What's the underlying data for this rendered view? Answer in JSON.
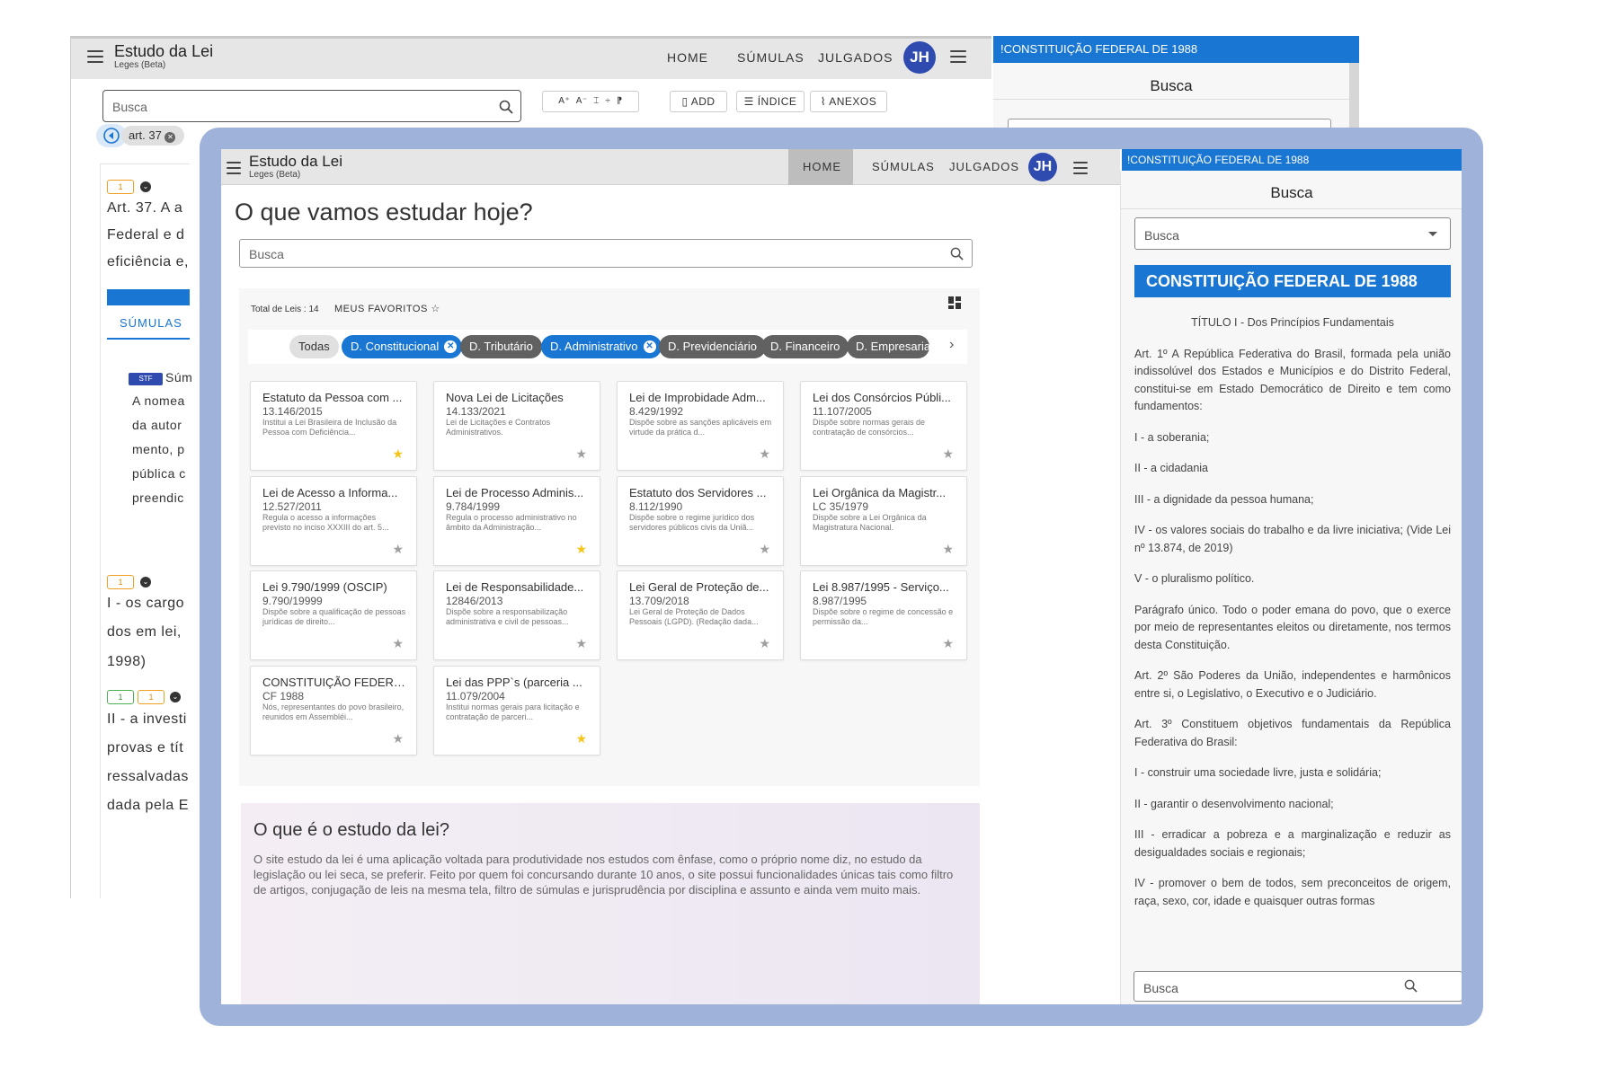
{
  "app": {
    "title": "Estudo da Lei",
    "subtitle": "Leges (Beta)",
    "avatar": "JH"
  },
  "nav": {
    "home": "HOME",
    "sumulas": "SÚMULAS",
    "julgados": "JULGADOS"
  },
  "right_panel": {
    "header": "!CONSTITUIÇÃO FEDERAL DE 1988",
    "busca_title": "Busca",
    "select_placeholder": "Busca",
    "law_title": "CONSTITUIÇÃO FEDERAL DE 1988",
    "paragraphs": [
      "TÍTULO I - Dos Princípios Fundamentais",
      "Art. 1º A República Federativa do Brasil, formada pela união indissolúvel dos Estados e Municípios e do Distrito Federal, constitui-se em Estado Democrático de Direito e tem como fundamentos:",
      "I - a soberania;",
      "II - a cidadania",
      "III - a dignidade da pessoa humana;",
      "IV - os valores sociais do trabalho e da livre iniciativa; (Vide Lei nº 13.874, de 2019)",
      "V - o pluralismo político.",
      "Parágrafo único. Todo o poder emana do povo, que o exerce por meio de representantes eleitos ou diretamente, nos termos desta Constituição.",
      "Art. 2º São Poderes da União, independentes e harmônicos entre si, o Legislativo, o Executivo e o Judiciário.",
      "Art. 3º Constituem objetivos fundamentais da República Federativa do Brasil:",
      "I - construir uma sociedade livre, justa e solidária;",
      "II - garantir o desenvolvimento nacional;",
      "III - erradicar a pobreza e a marginalização e reduzir as desigualdades sociais e regionais;",
      "IV - promover o bem de todos, sem preconceitos de origem, raça, sexo, cor, idade e quaisquer outras formas"
    ],
    "bottom_search_placeholder": "Busca"
  },
  "background": {
    "search_placeholder": "Busca",
    "tools": {
      "add": "ADD",
      "indice": "ÍNDICE",
      "anexos": "ANEXOS"
    },
    "art_chip": "art. 37",
    "badge": "1",
    "sumulas_tab": "SÚMULAS",
    "stf_label": "STF",
    "text_lines": [
      "Art. 37. A a",
      "Federal e d",
      "eficiência e,",
      "Súm",
      "A nomea",
      "da autor",
      "mento, p",
      "pública c",
      "preendic",
      "I - os cargo",
      "dos em lei,",
      "1998)",
      "II - a investi",
      "provas e tít",
      "ressalvadas",
      "dada pela E"
    ]
  },
  "main": {
    "headline": "O que vamos estudar hoje?",
    "search_placeholder": "Busca",
    "total_label": "Total de Leis : 14",
    "favorites_label": "MEUS FAVORITOS ☆",
    "chips": [
      {
        "label": "Todas",
        "style": "grey"
      },
      {
        "label": "D. Constitucional",
        "style": "blue"
      },
      {
        "label": "D. Tributário",
        "style": "dark"
      },
      {
        "label": "D. Administrativo",
        "style": "blue"
      },
      {
        "label": "D. Previdenciário",
        "style": "dark"
      },
      {
        "label": "D. Financeiro",
        "style": "dark"
      },
      {
        "label": "D. Empresarial",
        "style": "dark"
      }
    ],
    "laws": [
      {
        "title": "Estatuto da Pessoa com ...",
        "number": "13.146/2015",
        "desc": "Institui a Lei Brasileira de Inclusão da Pessoa com Deficiência...",
        "favorite": true
      },
      {
        "title": "Nova Lei de Licitações",
        "number": "14.133/2021",
        "desc": "Lei de Licitações e Contratos Administrativos.",
        "favorite": false
      },
      {
        "title": "Lei de Improbidade Adm...",
        "number": "8.429/1992",
        "desc": "Dispõe sobre as sanções aplicáveis em virtude da prática d...",
        "favorite": false
      },
      {
        "title": "Lei dos Consórcios Públi...",
        "number": "11.107/2005",
        "desc": "Dispõe sobre normas gerais de contratação de consórcios...",
        "favorite": false
      },
      {
        "title": "Lei de Acesso a Informa...",
        "number": "12.527/2011",
        "desc": "Regula o acesso a informações previsto no inciso XXXIII do art. 5...",
        "favorite": false
      },
      {
        "title": "Lei de Processo Adminis...",
        "number": "9.784/1999",
        "desc": "Regula o processo administrativo no âmbito da Administração...",
        "favorite": true
      },
      {
        "title": "Estatuto dos Servidores ...",
        "number": "8.112/1990",
        "desc": "Dispõe sobre o regime jurídico dos servidores públicos civis da Uniã...",
        "favorite": false
      },
      {
        "title": "Lei Orgânica da Magistr...",
        "number": "LC 35/1979",
        "desc": "Dispõe sobre a Lei Orgânica da Magistratura Nacional.",
        "favorite": false
      },
      {
        "title": "Lei 9.790/1999 (OSCIP)",
        "number": "9.790/19999",
        "desc": "Dispõe sobre a qualificação de pessoas jurídicas de direito...",
        "favorite": false
      },
      {
        "title": "Lei de Responsabilidade...",
        "number": "12846/2013",
        "desc": "Dispõe sobre a responsabilização administrativa e civil de pessoas...",
        "favorite": false
      },
      {
        "title": "Lei Geral de Proteção de...",
        "number": "13.709/2018",
        "desc": "Lei Geral de Proteção de Dados Pessoais (LGPD). (Redação dada...",
        "favorite": false
      },
      {
        "title": "Lei 8.987/1995 - Serviço...",
        "number": "8.987/1995",
        "desc": "Dispõe sobre o regime de concessão e permissão da...",
        "favorite": false
      },
      {
        "title": "CONSTITUIÇÃO FEDERA...",
        "number": "CF 1988",
        "desc": "Nós, representantes do povo brasileiro, reunidos em Assembléi...",
        "favorite": false
      },
      {
        "title": "Lei das PPP`s (parceria ...",
        "number": "11.079/2004",
        "desc": "Institui normas gerais para licitação e contratação de parceri...",
        "favorite": true
      }
    ],
    "about_title": "O que é o estudo da lei?",
    "about_text": "O site estudo da lei é uma aplicação voltada para produtividade nos estudos com ênfase, como o próprio nome diz, no estudo da legislação ou lei seca, se preferir. Feito por quem foi concursando durante 10 anos, o site possui funcionalidades únicas tais como filtro de artigos, conjugação de leis na mesma tela, filtro de súmulas e jurisprudência por disciplina e assunto e ainda vem muito mais."
  },
  "colors": {
    "primary": "#1976d2",
    "avatar": "#2f4bb0",
    "frame": "#9fb2da",
    "star_on": "#f5c518"
  }
}
